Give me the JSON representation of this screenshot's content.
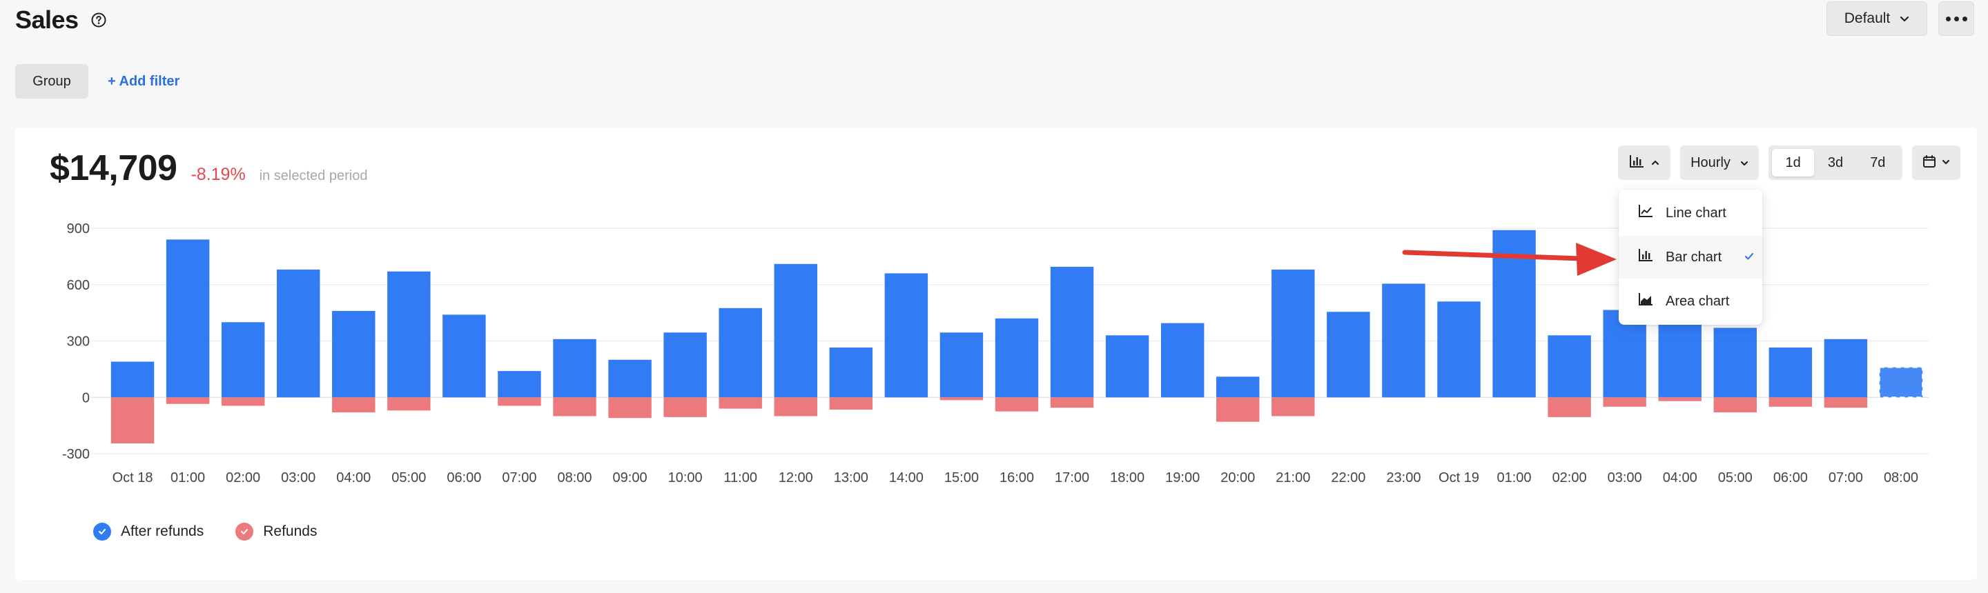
{
  "header": {
    "title": "Sales",
    "default_label": "Default"
  },
  "filters": {
    "group_label": "Group",
    "add_filter_label": "+ Add filter"
  },
  "summary": {
    "total": "$14,709",
    "change": "-8.19%",
    "note": "in selected period"
  },
  "controls": {
    "interval_label": "Hourly",
    "ranges": [
      "1d",
      "3d",
      "7d"
    ],
    "active_range": "1d"
  },
  "chart_menu": {
    "items": [
      {
        "label": "Line chart",
        "icon": "line-chart-icon",
        "selected": false
      },
      {
        "label": "Bar chart",
        "icon": "bar-chart-icon",
        "selected": true
      },
      {
        "label": "Area chart",
        "icon": "area-chart-icon",
        "selected": false
      }
    ]
  },
  "colors": {
    "after_refunds": "#317cf5",
    "refunds": "#ec7a7c",
    "accent": "#2a6fe3",
    "negative": "#e5484d",
    "annotation_arrow": "#e03a32"
  },
  "legend": {
    "after_refunds": "After refunds",
    "refunds": "Refunds"
  },
  "chart_data": {
    "type": "bar",
    "stacked": true,
    "categories": [
      "Oct 18",
      "01:00",
      "02:00",
      "03:00",
      "04:00",
      "05:00",
      "06:00",
      "07:00",
      "08:00",
      "09:00",
      "10:00",
      "11:00",
      "12:00",
      "13:00",
      "14:00",
      "15:00",
      "16:00",
      "17:00",
      "18:00",
      "19:00",
      "20:00",
      "21:00",
      "22:00",
      "23:00",
      "Oct 19",
      "01:00",
      "02:00",
      "03:00",
      "04:00",
      "05:00",
      "06:00",
      "07:00",
      "08:00"
    ],
    "series": [
      {
        "name": "After refunds",
        "values": [
          190,
          840,
          400,
          680,
          460,
          670,
          440,
          140,
          310,
          200,
          345,
          475,
          710,
          265,
          660,
          345,
          420,
          695,
          330,
          395,
          110,
          680,
          455,
          605,
          510,
          890,
          330,
          465,
          420,
          370,
          265,
          310,
          160
        ]
      },
      {
        "name": "Refunds",
        "values": [
          -245,
          -35,
          -45,
          0,
          -80,
          -70,
          0,
          -45,
          -100,
          -110,
          -105,
          -60,
          -100,
          -65,
          0,
          -15,
          -75,
          -55,
          0,
          0,
          -130,
          -100,
          0,
          0,
          0,
          0,
          -105,
          -50,
          -20,
          -80,
          -50,
          -55,
          0
        ]
      }
    ],
    "partial_last_bar": true,
    "ylim": [
      -300,
      900
    ],
    "yticks": [
      -300,
      0,
      300,
      600,
      900
    ],
    "grid": true,
    "legend_position": "bottom-left"
  }
}
